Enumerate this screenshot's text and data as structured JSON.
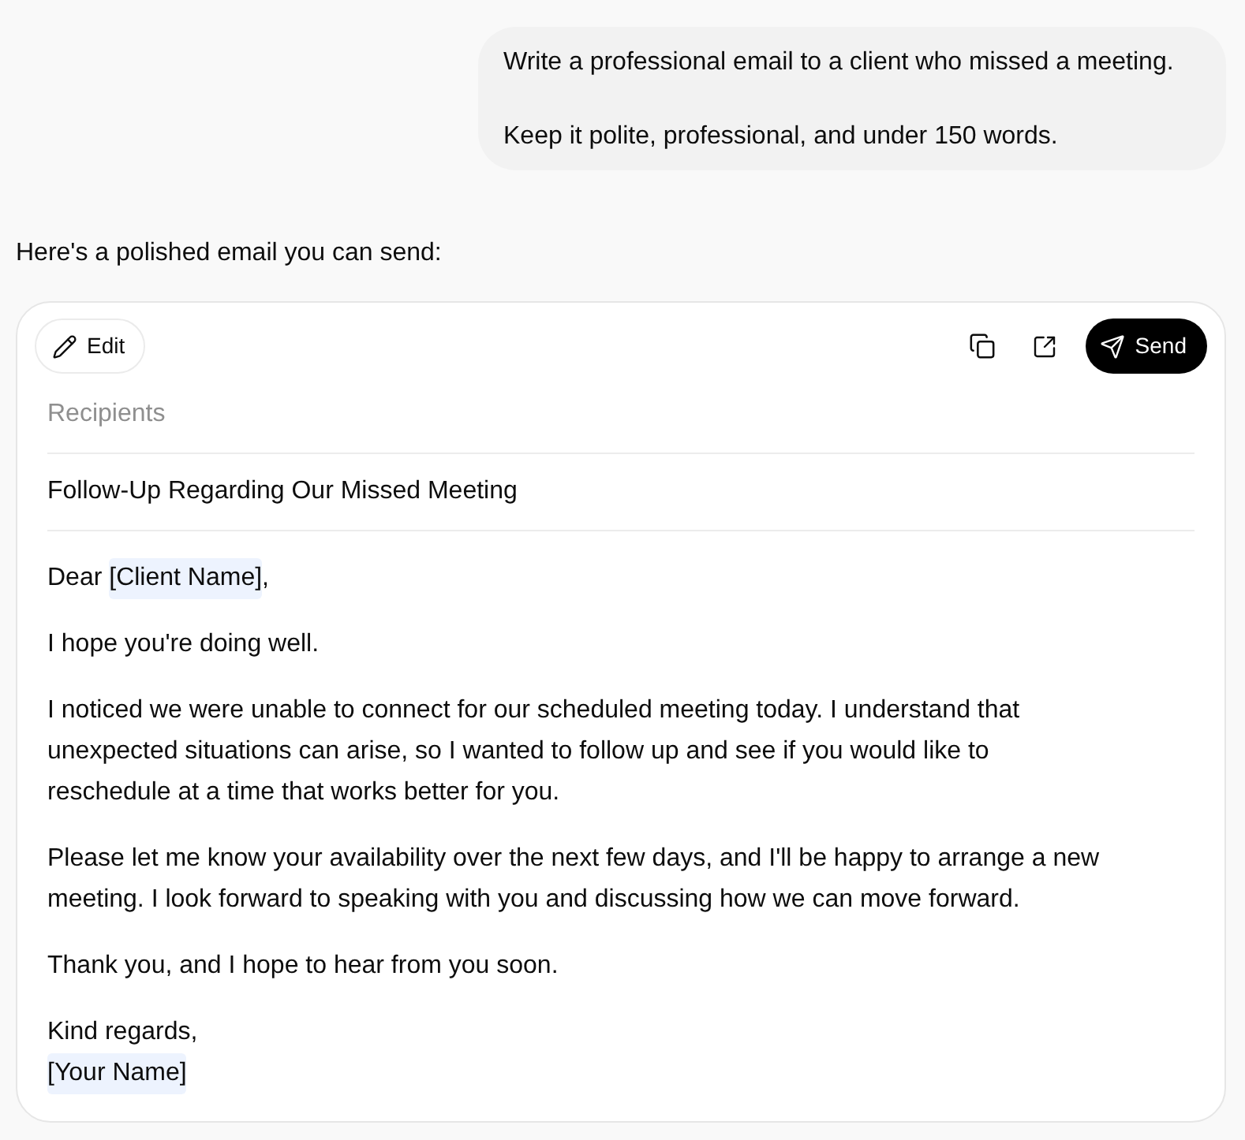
{
  "user_message": {
    "lines": [
      "Write a professional email to a client who missed a meeting.",
      "Keep it polite, professional, and under 150 words."
    ]
  },
  "assistant": {
    "intro": "Here's a polished email you can send:"
  },
  "email_card": {
    "edit_button": "Edit",
    "send_button": "Send",
    "recipients": {
      "placeholder": "Recipients"
    },
    "subject": "Follow-Up Regarding Our Missed Meeting",
    "body": [
      {
        "lines": [
          {
            "segments": [
              {
                "kind": "plain",
                "text": "Dear "
              },
              {
                "kind": "placeholder",
                "text": "[Client Name]"
              },
              {
                "kind": "plain",
                "text": ","
              }
            ]
          }
        ]
      },
      {
        "lines": [
          {
            "segments": [
              {
                "kind": "plain",
                "text": "I hope you're doing well."
              }
            ]
          }
        ]
      },
      {
        "lines": [
          {
            "segments": [
              {
                "kind": "plain",
                "text": "I noticed we were unable to connect for our scheduled meeting today. I understand that unexpected situations can arise, so I wanted to follow up and see if you would like to reschedule at a time that works better for you."
              }
            ]
          }
        ]
      },
      {
        "lines": [
          {
            "segments": [
              {
                "kind": "plain",
                "text": "Please let me know your availability over the next few days, and I'll be happy to arrange a new meeting. I look forward to speaking with you and discussing how we can move forward."
              }
            ]
          }
        ]
      },
      {
        "lines": [
          {
            "segments": [
              {
                "kind": "plain",
                "text": "Thank you, and I hope to hear from you soon."
              }
            ]
          }
        ]
      },
      {
        "lines": [
          {
            "segments": [
              {
                "kind": "plain",
                "text": "Kind regards,"
              }
            ]
          },
          {
            "segments": [
              {
                "kind": "placeholder",
                "text": "[Your Name]"
              }
            ]
          }
        ]
      }
    ]
  }
}
